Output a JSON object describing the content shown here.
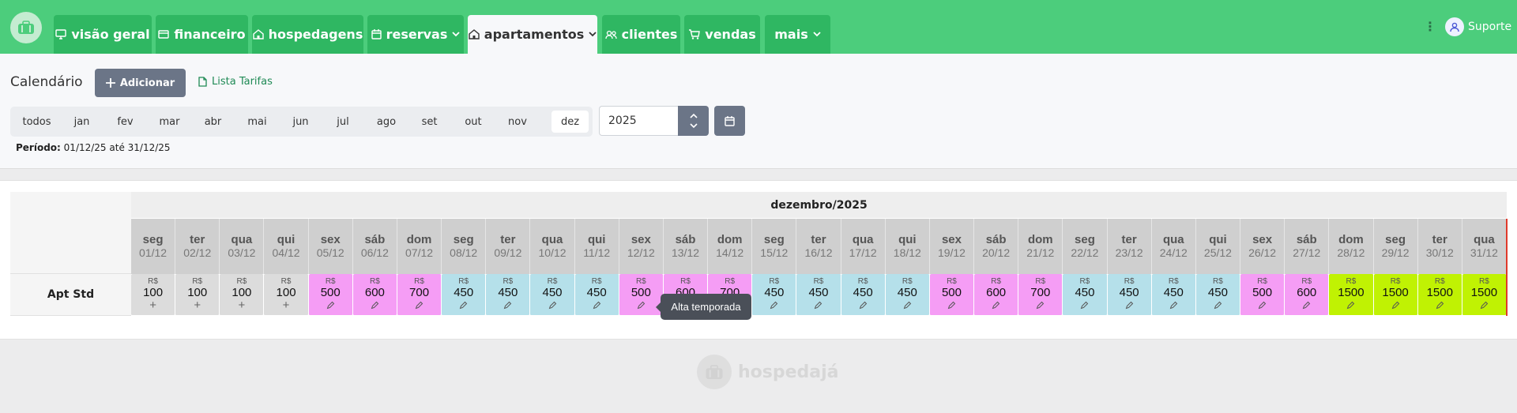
{
  "nav": {
    "tabs": [
      {
        "label": "visão geral",
        "icon": "monitor-icon"
      },
      {
        "label": "financeiro",
        "icon": "card-icon"
      },
      {
        "label": "hospedagens",
        "icon": "house-icon"
      },
      {
        "label": "reservas",
        "icon": "calendar-icon"
      },
      {
        "label": "apartamentos",
        "icon": "house-icon"
      },
      {
        "label": "clientes",
        "icon": "users-icon"
      },
      {
        "label": "vendas",
        "icon": "cart-icon"
      },
      {
        "label": "mais",
        "icon": ""
      }
    ],
    "active_tab": "apartamentos",
    "user_label": "Suporte"
  },
  "header": {
    "title": "Calendário",
    "add_label": "Adicionar",
    "tarifas_label": "Lista Tarifas",
    "months": [
      "todos",
      "jan",
      "fev",
      "mar",
      "abr",
      "mai",
      "jun",
      "jul",
      "ago",
      "set",
      "out",
      "nov",
      "dez"
    ],
    "active_month": "dez",
    "year_value": "2025",
    "periodo_label": "Período:",
    "periodo_value": "01/12/25 até 31/12/25"
  },
  "calendar": {
    "month_title": "dezembro/2025",
    "apartment": "Apt Std",
    "currency": "R$",
    "days": [
      {
        "dow": "seg",
        "date": "01/12",
        "price": "100",
        "tier": "base"
      },
      {
        "dow": "ter",
        "date": "02/12",
        "price": "100",
        "tier": "base"
      },
      {
        "dow": "qua",
        "date": "03/12",
        "price": "100",
        "tier": "base"
      },
      {
        "dow": "qui",
        "date": "04/12",
        "price": "100",
        "tier": "base"
      },
      {
        "dow": "sex",
        "date": "05/12",
        "price": "500",
        "tier": "alta"
      },
      {
        "dow": "sáb",
        "date": "06/12",
        "price": "600",
        "tier": "alta"
      },
      {
        "dow": "dom",
        "date": "07/12",
        "price": "700",
        "tier": "alta"
      },
      {
        "dow": "seg",
        "date": "08/12",
        "price": "450",
        "tier": "media"
      },
      {
        "dow": "ter",
        "date": "09/12",
        "price": "450",
        "tier": "media"
      },
      {
        "dow": "qua",
        "date": "10/12",
        "price": "450",
        "tier": "media"
      },
      {
        "dow": "qui",
        "date": "11/12",
        "price": "450",
        "tier": "media"
      },
      {
        "dow": "sex",
        "date": "12/12",
        "price": "500",
        "tier": "alta"
      },
      {
        "dow": "sáb",
        "date": "13/12",
        "price": "600",
        "tier": "alta"
      },
      {
        "dow": "dom",
        "date": "14/12",
        "price": "700",
        "tier": "alta"
      },
      {
        "dow": "seg",
        "date": "15/12",
        "price": "450",
        "tier": "media"
      },
      {
        "dow": "ter",
        "date": "16/12",
        "price": "450",
        "tier": "media"
      },
      {
        "dow": "qua",
        "date": "17/12",
        "price": "450",
        "tier": "media"
      },
      {
        "dow": "qui",
        "date": "18/12",
        "price": "450",
        "tier": "media"
      },
      {
        "dow": "sex",
        "date": "19/12",
        "price": "500",
        "tier": "alta"
      },
      {
        "dow": "sáb",
        "date": "20/12",
        "price": "600",
        "tier": "alta"
      },
      {
        "dow": "dom",
        "date": "21/12",
        "price": "700",
        "tier": "alta"
      },
      {
        "dow": "seg",
        "date": "22/12",
        "price": "450",
        "tier": "media"
      },
      {
        "dow": "ter",
        "date": "23/12",
        "price": "450",
        "tier": "media"
      },
      {
        "dow": "qua",
        "date": "24/12",
        "price": "450",
        "tier": "media"
      },
      {
        "dow": "qui",
        "date": "25/12",
        "price": "450",
        "tier": "media"
      },
      {
        "dow": "sex",
        "date": "26/12",
        "price": "500",
        "tier": "alta"
      },
      {
        "dow": "sáb",
        "date": "27/12",
        "price": "600",
        "tier": "alta"
      },
      {
        "dow": "dom",
        "date": "28/12",
        "price": "1500",
        "tier": "festa"
      },
      {
        "dow": "seg",
        "date": "29/12",
        "price": "1500",
        "tier": "festa"
      },
      {
        "dow": "ter",
        "date": "30/12",
        "price": "1500",
        "tier": "festa"
      },
      {
        "dow": "qua",
        "date": "31/12",
        "price": "1500",
        "tier": "festa"
      }
    ],
    "tier_colors": {
      "base": "#dcdcdc",
      "alta": "#f59df5",
      "media": "#b5e0ea",
      "festa": "#c0f203"
    },
    "tooltip": "Alta temporada"
  },
  "footer": {
    "brand": "hospedajá"
  }
}
